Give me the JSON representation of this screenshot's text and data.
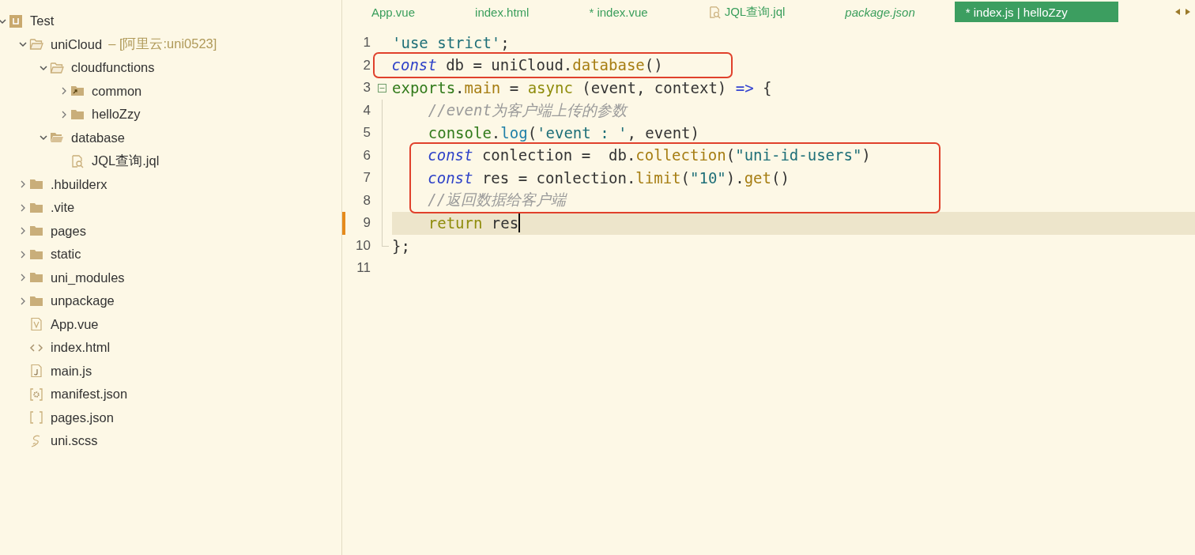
{
  "sidebar": {
    "tree": [
      {
        "label": "Test",
        "kind": "project",
        "expanded": true,
        "children": [
          {
            "label": "uniCloud",
            "tag": "– [阿里云:uni0523]",
            "kind": "folder-open",
            "expanded": true,
            "children": [
              {
                "label": "cloudfunctions",
                "kind": "folder-open",
                "expanded": true,
                "children": [
                  {
                    "label": "common",
                    "kind": "folder-link",
                    "expanded": false
                  },
                  {
                    "label": "helloZzy",
                    "kind": "folder",
                    "expanded": false
                  }
                ]
              },
              {
                "label": "database",
                "kind": "folder-filled",
                "expanded": true,
                "children": [
                  {
                    "label": "JQL查询.jql",
                    "kind": "query"
                  }
                ]
              }
            ]
          },
          {
            "label": ".hbuilderx",
            "kind": "folder",
            "expanded": false
          },
          {
            "label": ".vite",
            "kind": "folder",
            "expanded": false
          },
          {
            "label": "pages",
            "kind": "folder",
            "expanded": false
          },
          {
            "label": "static",
            "kind": "folder",
            "expanded": false
          },
          {
            "label": "uni_modules",
            "kind": "folder",
            "expanded": false
          },
          {
            "label": "unpackage",
            "kind": "folder",
            "expanded": false
          },
          {
            "label": "App.vue",
            "kind": "vue"
          },
          {
            "label": "index.html",
            "kind": "html"
          },
          {
            "label": "main.js",
            "kind": "js"
          },
          {
            "label": "manifest.json",
            "kind": "manifest"
          },
          {
            "label": "pages.json",
            "kind": "json"
          },
          {
            "label": "uni.scss",
            "kind": "scss"
          }
        ]
      }
    ]
  },
  "tabs": [
    {
      "label": "App.vue",
      "kind": "plain",
      "selected": false,
      "preview": false
    },
    {
      "label": "index.html",
      "kind": "plain",
      "selected": false,
      "preview": false
    },
    {
      "label": "* index.vue",
      "kind": "plain",
      "selected": false,
      "preview": false
    },
    {
      "label": "JQL查询.jql",
      "kind": "query",
      "selected": false,
      "preview": false
    },
    {
      "label": "package.json",
      "kind": "plain",
      "selected": false,
      "preview": true
    },
    {
      "label": "* index.js | helloZzy",
      "kind": "plain",
      "selected": true,
      "preview": false
    }
  ],
  "editor": {
    "lines": [
      {
        "number": "1",
        "kind": "plain",
        "boxed": false,
        "current": false,
        "tokens": [
          {
            "kind": "string",
            "t": "'use strict'"
          },
          {
            "kind": "plain",
            "t": ";"
          }
        ]
      },
      {
        "number": "2",
        "kind": "plain",
        "boxed": true,
        "current": false,
        "tokens": [
          {
            "kind": "keyword",
            "t": "const"
          },
          {
            "kind": "plain",
            "t": " db = uniCloud."
          },
          {
            "kind": "method",
            "t": "database"
          },
          {
            "kind": "plain",
            "t": "()"
          }
        ]
      },
      {
        "number": "3",
        "kind": "fold-start",
        "boxed": false,
        "current": false,
        "tokens": [
          {
            "kind": "object",
            "t": "exports"
          },
          {
            "kind": "plain",
            "t": "."
          },
          {
            "kind": "method",
            "t": "main"
          },
          {
            "kind": "plain",
            "t": " = "
          },
          {
            "kind": "storage",
            "t": "async"
          },
          {
            "kind": "plain",
            "t": " (event, context) "
          },
          {
            "kind": "operator",
            "t": "=>"
          },
          {
            "kind": "plain",
            "t": " {"
          }
        ]
      },
      {
        "number": "4",
        "kind": "fold-body",
        "boxed": false,
        "current": false,
        "tokens": [
          {
            "kind": "comment",
            "t": "    //event为客户端上传的参数"
          }
        ]
      },
      {
        "number": "5",
        "kind": "fold-body",
        "boxed": false,
        "current": false,
        "tokens": [
          {
            "kind": "object",
            "t": "    console"
          },
          {
            "kind": "plain",
            "t": "."
          },
          {
            "kind": "builtin",
            "t": "log"
          },
          {
            "kind": "plain",
            "t": "("
          },
          {
            "kind": "string",
            "t": "'event : '"
          },
          {
            "kind": "plain",
            "t": ", event)"
          }
        ]
      },
      {
        "number": "6",
        "kind": "fold-body",
        "boxed": true,
        "current": false,
        "tokens": [
          {
            "kind": "keyword",
            "t": "    const"
          },
          {
            "kind": "plain",
            "t": " conlection =  db."
          },
          {
            "kind": "method",
            "t": "collection"
          },
          {
            "kind": "plain",
            "t": "("
          },
          {
            "kind": "string",
            "t": "\"uni-id-users\""
          },
          {
            "kind": "plain",
            "t": ")"
          }
        ]
      },
      {
        "number": "7",
        "kind": "fold-body",
        "boxed": true,
        "current": false,
        "tokens": [
          {
            "kind": "keyword",
            "t": "    const"
          },
          {
            "kind": "plain",
            "t": " res = conlection."
          },
          {
            "kind": "method",
            "t": "limit"
          },
          {
            "kind": "plain",
            "t": "("
          },
          {
            "kind": "string",
            "t": "\"10\""
          },
          {
            "kind": "plain",
            "t": ")."
          },
          {
            "kind": "method",
            "t": "get"
          },
          {
            "kind": "plain",
            "t": "()"
          }
        ]
      },
      {
        "number": "8",
        "kind": "fold-body",
        "boxed": true,
        "current": false,
        "tokens": [
          {
            "kind": "comment",
            "t": "    //返回数据给客户端"
          }
        ]
      },
      {
        "number": "9",
        "kind": "fold-body",
        "boxed": false,
        "current": true,
        "tokens": [
          {
            "kind": "storage",
            "t": "    return"
          },
          {
            "kind": "plain",
            "t": " res"
          }
        ]
      },
      {
        "number": "10",
        "kind": "fold-end",
        "boxed": false,
        "current": false,
        "tokens": [
          {
            "kind": "plain",
            "t": "};"
          }
        ]
      },
      {
        "number": "11",
        "kind": "plain"
      }
    ]
  }
}
